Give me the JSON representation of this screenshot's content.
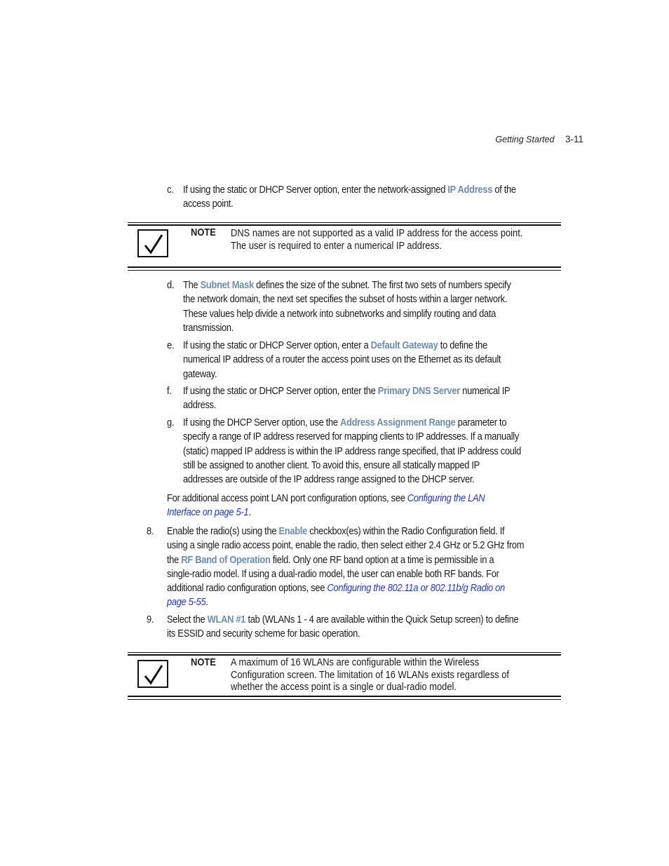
{
  "header": {
    "section": "Getting Started",
    "page_number": "3-11"
  },
  "colors": {
    "emphasis": "#6d8db0",
    "link": "#1e35e6"
  },
  "step_c": {
    "label": "c.",
    "t1": "If using the static or DHCP Server option, enter the network-assigned ",
    "em": "IP Address",
    "t2": " of the",
    "t3": "access point."
  },
  "note1": {
    "label": "NOTE",
    "lines": [
      "DNS names are not supported as a valid IP address for the access point.",
      "The user is required to enter a numerical IP address."
    ]
  },
  "step_d": {
    "label": "d.",
    "t1": "The ",
    "em": "Subnet Mask",
    "t2": " defines the size of the subnet. The first two sets of numbers specify",
    "lines": [
      "the network domain, the next set specifies the subset of hosts within a larger network.",
      "These values help divide a network into subnetworks and simplify routing and data",
      "transmission."
    ]
  },
  "step_e": {
    "label": "e.",
    "t1": "If using the static or DHCP Server option, enter a ",
    "em": "Default Gateway",
    "t2": " to define the",
    "lines": [
      "numerical IP address of a router the access point uses on the Ethernet as its default",
      "gateway."
    ]
  },
  "step_f": {
    "label": "f.",
    "t1": "If using the static or DHCP Server option, enter the ",
    "em": "Primary DNS Server",
    "t2": " numerical IP",
    "lines": [
      "address."
    ]
  },
  "step_g": {
    "label": "g.",
    "t1": "If using the DHCP Server option, use the ",
    "em": "Address Assignment Range",
    "t2": " parameter to",
    "lines": [
      "specify a range of IP address reserved for mapping clients to IP addresses. If a manually",
      "(static) mapped IP address is within the IP address range specified, that IP address could",
      "still be assigned to another client. To avoid this, ensure all statically mapped IP",
      "addresses are outside of the IP address range assigned to the DHCP server."
    ]
  },
  "lan_para": {
    "t1": "For additional access point LAN port configuration options, see ",
    "link1": "Configuring the LAN",
    "link2": "Interface on page 5-1",
    "t2": "."
  },
  "step_8": {
    "label": "8.",
    "t1": "Enable the radio(s) using the ",
    "em1": "Enable",
    "t2": " checkbox(es) within the Radio Configuration field. If",
    "line2": "using a single radio access point, enable the radio, then select either 2.4 GHz or 5.2 GHz from",
    "t3": "the ",
    "em2": "RF Band of Operation",
    "t4": " field. Only one RF band option at a time is permissible in a",
    "line4": "single-radio model. If using a dual-radio model, the user can enable both RF bands. For",
    "t5": "additional radio configuration options, see ",
    "link1": "Configuring the 802.11a or 802.11b/g Radio on",
    "link2": "page 5-55",
    "t6": "."
  },
  "step_9": {
    "label": "9.",
    "t1": "Select the ",
    "em": "WLAN #1",
    "t2": " tab (WLANs 1 - 4 are available within the Quick Setup screen) to define",
    "line2": "its ESSID and security scheme for basic operation."
  },
  "note2": {
    "label": "NOTE",
    "lines": [
      "A maximum of 16 WLANs are configurable within the Wireless",
      "Configuration screen. The limitation of 16 WLANs exists regardless of",
      "whether the access point is a single or dual-radio model."
    ]
  }
}
